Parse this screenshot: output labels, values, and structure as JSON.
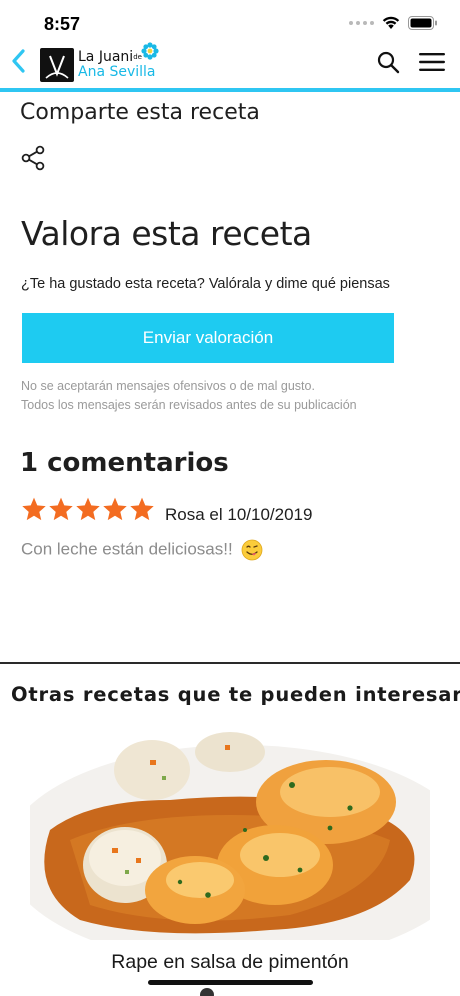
{
  "status_bar": {
    "time": "8:57"
  },
  "header": {
    "logo": {
      "line1": "La Juani",
      "line1_suffix": "de",
      "line2": "Ana Sevilla"
    },
    "accent_color": "#2fc6f2",
    "icons": [
      "chevron-left-icon",
      "search-icon",
      "hamburger-menu-icon"
    ]
  },
  "share": {
    "title": "Comparte esta receta",
    "icon": "share-icon"
  },
  "rating": {
    "title": "Valora esta receta",
    "prompt": "¿Te ha gustado esta receta? Valórala y dime qué piensas",
    "button_label": "Enviar valoración",
    "button_color": "#1ecbf1",
    "notice_line1": "No se aceptarán mensajes ofensivos o de mal gusto.",
    "notice_line2": "Todos los mensajes serán revisados antes de su publicación"
  },
  "comments": {
    "title": "1 comentarios",
    "items": [
      {
        "stars": 5,
        "author": "Rosa el 10/10/2019",
        "text": "Con leche están deliciosas!!",
        "emoji": "😋"
      }
    ],
    "star_color": "#f36c21"
  },
  "related": {
    "title": "Otras recetas que te pueden interesar",
    "recipes": [
      {
        "title": "Rape en salsa de pimentón"
      }
    ]
  }
}
